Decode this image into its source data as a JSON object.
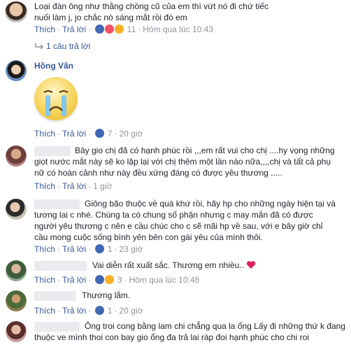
{
  "comments": [
    {
      "text_lines": [
        "Loại đàn ông như thằng chồng cũ của em thì vứt nó đi chứ tiếc",
        "nuối làm j, jo chắc nó sáng mắt rồi đó em"
      ],
      "like": "Thích",
      "reply": "Trả lời",
      "reaction_count": "11",
      "time": "Hôm qua lúc 10:43"
    },
    {
      "name": "Hồng Vân",
      "like": "Thích",
      "reply": "Trả lời",
      "reaction_count": "7",
      "time": "20 giờ"
    },
    {
      "text_lines": [
        "Bây gio chị đã có hạnh phúc rồi ,,,em rất vui cho chị ....hy vọng những",
        "giọt nước mắt này sẽ ko lặp lại với chị thêm một lần nào nữa,,,,chị và tất cả phụ",
        "nữ có hoàn cảnh như này đều xứng đáng có được yêu thương ....."
      ],
      "like": "Thích",
      "reply": "Trả lời",
      "time": "1 giờ"
    },
    {
      "text_lines": [
        "Giông bão thuộc về quá khứ rồi, hãy hp cho những ngày hiện tại và",
        "tương lai c nhé. Chúng ta có chung số phận nhưng c may mắn đã có được",
        "người yêu thương c nên e cầu chúc cho c sẽ mãi hp về sau, với e bây giờ chỉ",
        "cầu mong cuộc sống bình yên bên con gái yêu của mình thôi."
      ],
      "like": "Thích",
      "reply": "Trả lời",
      "reaction_count": "1",
      "time": "23 giờ"
    },
    {
      "text_lines": [
        "Vai diễn rất xuất sắc. Thương em nhiều.."
      ],
      "like": "Thích",
      "reply": "Trả lời",
      "reaction_count": "3",
      "time": "Hôm qua lúc 10:48"
    },
    {
      "text_lines": [
        "Thương lắm."
      ],
      "like": "Thích",
      "reply": "Trả lời",
      "reaction_count": "1",
      "time": "20 giờ"
    },
    {
      "text_lines": [
        "Ông troi cong bằng lam chi chẳng qua la ổng Lấy đi những thứ k đang",
        "thuộc ve mình thoi con bay gio ổng đa trả lai ráp đoi hạnh phúc cho chi roi"
      ]
    }
  ],
  "replies_link": "1 câu trả lời",
  "colors": {
    "link": "#365899",
    "meta": "#90949c",
    "like": "#4267b2",
    "love": "#f25268",
    "sad": "#f7b125"
  }
}
